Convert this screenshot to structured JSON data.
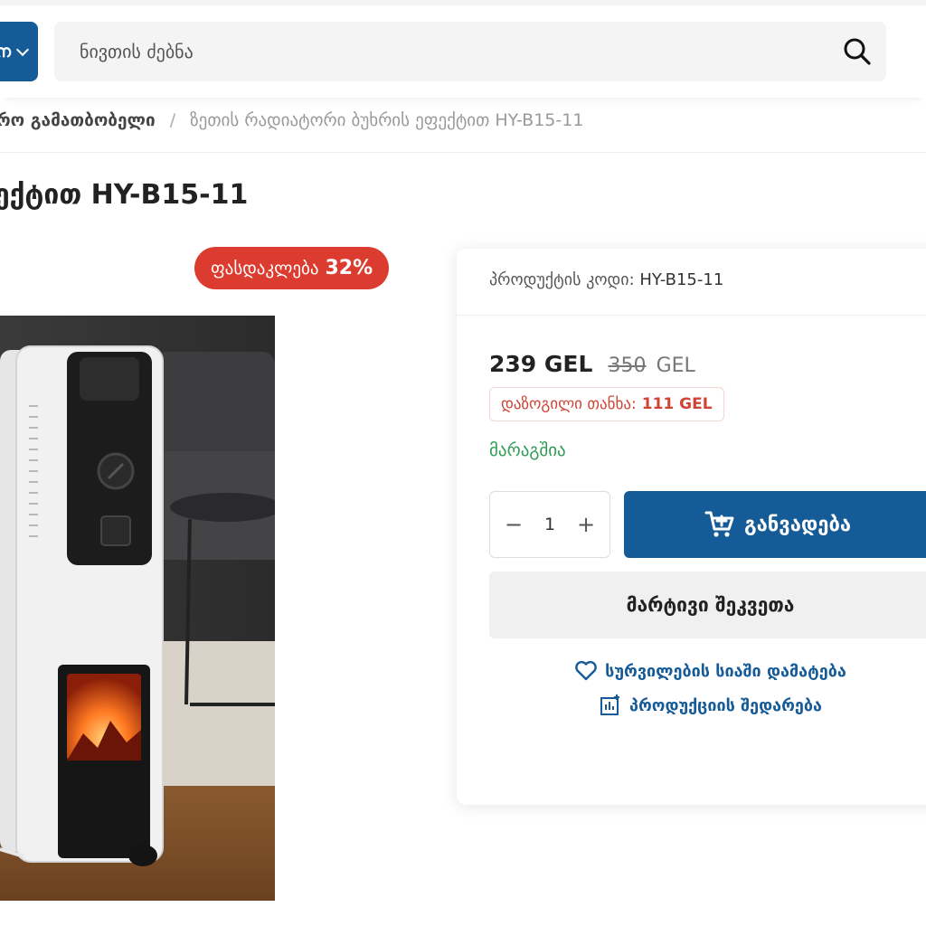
{
  "header": {
    "category_button_label": "ന",
    "search_placeholder": "ნივთის ძებნა"
  },
  "breadcrumb": {
    "parent": "რო გამათბობელი",
    "current": "ზეთის რადიატორი ბუხრის ეფექტით HY-B15-11"
  },
  "product": {
    "title": "ექტით HY-B15-11",
    "discount_label": "ფასდაკლება",
    "discount_value": "32%",
    "code_label": "პროდუქტის კოდი:",
    "code_value": "HY-B15-11",
    "price_new": "239 GEL",
    "price_old_amount": "350",
    "price_old_currency": "GEL",
    "saved_label": "დაზოგილი თანხა:",
    "saved_value": "111 GEL",
    "stock_status": "მარაგშია",
    "quantity": "1",
    "add_to_cart_label": "განვადება",
    "quick_buy_label": "მარტივი შეკვეთა",
    "wishlist_label": "სურვილების სიაში დამატება",
    "compare_label": "პროდუქციის შედარება"
  },
  "colors": {
    "brand_blue": "#155b97",
    "discount_red": "#dc3c2f",
    "stock_green": "#2e9d55"
  },
  "icons": [
    "search-icon",
    "chevron-down-icon",
    "cart-icon",
    "heart-icon",
    "compare-icon",
    "minus-icon",
    "plus-icon"
  ]
}
